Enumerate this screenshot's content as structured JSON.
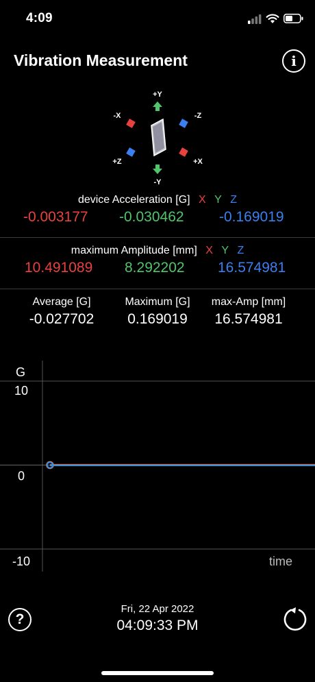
{
  "status_bar": {
    "time": "4:09"
  },
  "header": {
    "title": "Vibration Measurement"
  },
  "orientation": {
    "labels": {
      "plus_y": "+Y",
      "minus_y": "-Y",
      "minus_x": "-X",
      "minus_z": "-Z",
      "plus_z": "+Z",
      "plus_x": "+X"
    }
  },
  "acceleration": {
    "label": "device Acceleration [G]",
    "axis_x": "X",
    "axis_y": "Y",
    "axis_z": "Z",
    "x": "-0.003177",
    "y": "-0.030462",
    "z": "-0.169019"
  },
  "amplitude": {
    "label": "maximum Amplitude [mm]",
    "axis_x": "X",
    "axis_y": "Y",
    "axis_z": "Z",
    "x": "10.491089",
    "y": "8.292202",
    "z": "16.574981"
  },
  "stats": {
    "average_label": "Average [G]",
    "average_value": "-0.027702",
    "maximum_label": "Maximum [G]",
    "maximum_value": "0.169019",
    "maxamp_label": "max-Amp [mm]",
    "maxamp_value": "16.574981"
  },
  "chart_data": {
    "type": "line",
    "ylabel": "G",
    "xlabel": "time",
    "ylim": [
      -10,
      10
    ],
    "y_ticks": [
      "10",
      "0",
      "-10"
    ],
    "series": [
      {
        "color": "#e8423f",
        "values": [
          0,
          0
        ]
      },
      {
        "color": "#52c46b",
        "values": [
          0,
          0
        ]
      },
      {
        "color": "#3b7ff0",
        "values": [
          0,
          0
        ]
      }
    ]
  },
  "footer": {
    "date": "Fri, 22 Apr 2022",
    "time": "04:09:33 PM"
  },
  "colors": {
    "x": "#e8423f",
    "y": "#52c46b",
    "z": "#3b7ff0"
  }
}
